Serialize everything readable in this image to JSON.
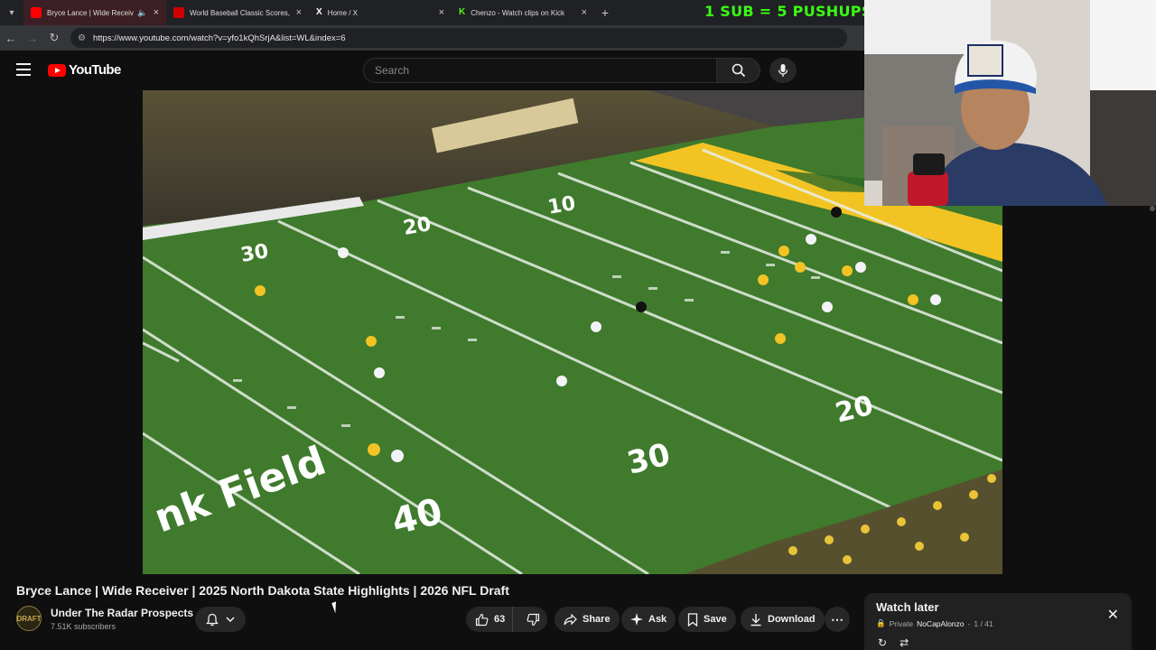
{
  "browser": {
    "tabs": [
      {
        "title": "Bryce Lance | Wide Receiver",
        "active": true,
        "favicon_color": "#ff0000",
        "audio": true
      },
      {
        "title": "World Baseball Classic Scores, ",
        "active": false,
        "favicon_color": "#d00000"
      },
      {
        "title": "Home / X",
        "active": false,
        "favicon_color": "#ffffff"
      },
      {
        "title": "Chenzo - Watch clips on Kick",
        "active": false,
        "favicon_color": "#53fc18"
      }
    ],
    "new_tab": "+",
    "url": "https://www.youtube.com/watch?v=yfo1kQhSrjA&list=WL&index=6"
  },
  "overlay": {
    "text": "1 SUB = 5 PUSHUPS",
    "color": "#39ff14"
  },
  "masthead": {
    "logo_text": "YouTube",
    "search_placeholder": "Search"
  },
  "video": {
    "field_numbers": [
      "10",
      "20",
      "30",
      "40",
      "20",
      "30"
    ],
    "end_zone_text": "nk Field"
  },
  "watch": {
    "title": "Bryce Lance | Wide Receiver | 2025 North Dakota State Highlights | 2026 NFL Draft",
    "channel_name": "Under The Radar Prospects",
    "channel_avatar_text": "DRAFT",
    "subscribers": "7.51K subscribers",
    "likes": "63",
    "actions": {
      "share": "Share",
      "ask": "Ask",
      "save": "Save",
      "download": "Download"
    }
  },
  "playlist": {
    "title": "Watch later",
    "privacy": "Private",
    "owner": "NoCapAlonzo",
    "position": "1 / 41"
  },
  "colors": {
    "brand_red": "#ff0000",
    "background": "#0f0f0f",
    "field_green": "#3f7a2d",
    "end_zone_yellow": "#f2c423"
  }
}
